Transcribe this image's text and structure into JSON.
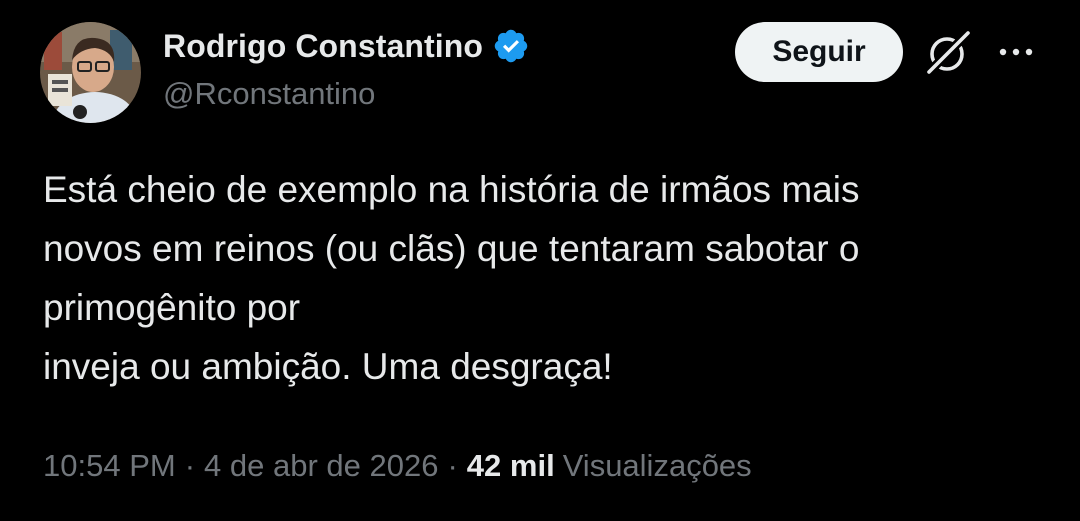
{
  "tweet": {
    "author": {
      "name": "Rodrigo Constantino",
      "handle": "@Rconstantino",
      "verified": true
    },
    "follow_label": "Seguir",
    "text": "Está cheio de exemplo na história de irmãos mais\nnovos em reinos (ou clãs) que tentaram sabotar o\nprimogênito por\ninveja ou ambição. Uma desgraça!",
    "meta": {
      "time": "10:54 PM",
      "separator": "·",
      "date": "4 de abr de 2026",
      "views_count": "42 mil",
      "views_label": "Visualizações"
    }
  },
  "icons": {
    "verified": "verified-badge-icon",
    "grok": "grok-icon",
    "more": "more-options-icon"
  },
  "colors": {
    "background": "#000000",
    "text_primary": "#e7e9ea",
    "text_secondary": "#71767b",
    "verified_blue": "#1d9bf0",
    "button_bg": "#eff3f4",
    "button_text": "#0f1419"
  }
}
